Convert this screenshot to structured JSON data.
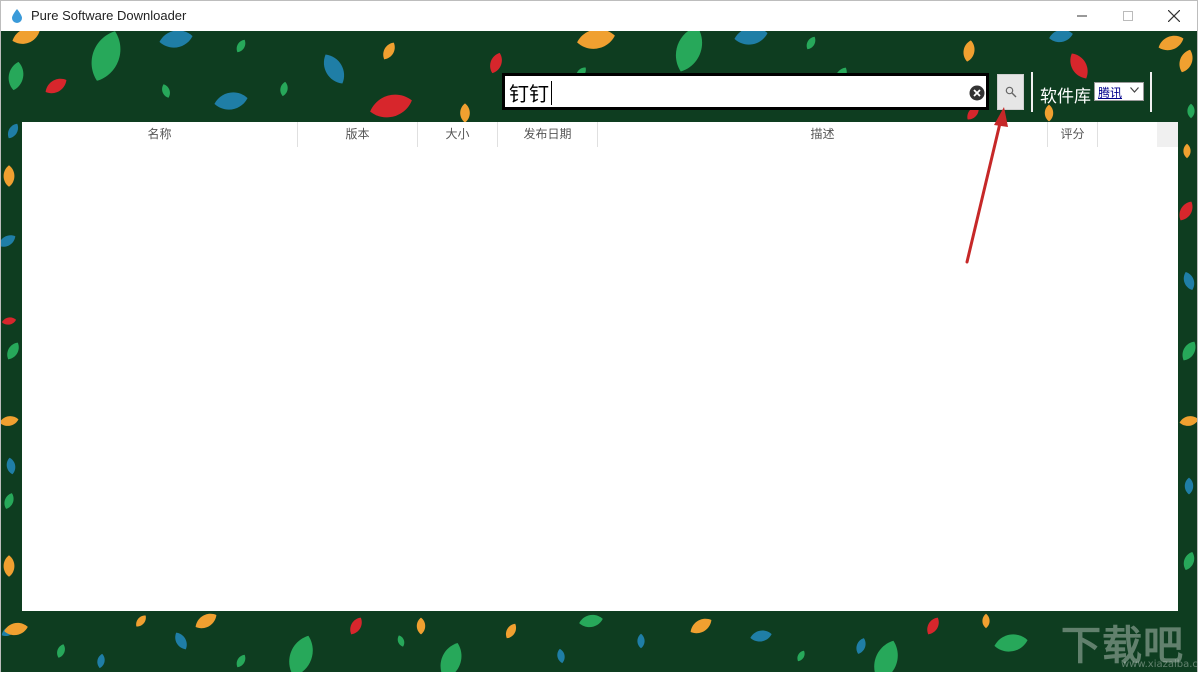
{
  "window": {
    "title": "Pure Software Downloader",
    "minimize_icon": "minimize-icon",
    "maximize_icon": "maximize-icon",
    "close_icon": "close-icon"
  },
  "search": {
    "value": "钉钉",
    "clear_icon": "clear-circle-icon",
    "button_icon": "search-icon"
  },
  "library": {
    "label": "软件库",
    "selected": "腾讯"
  },
  "table": {
    "columns": [
      "名称",
      "版本",
      "大小",
      "发布日期",
      "描述",
      "评分"
    ],
    "rows": []
  },
  "watermark": {
    "text": "下载吧",
    "sub": "www.xiazaiba.com"
  },
  "colors": {
    "background": "#0e3d20",
    "leaf_green": "#27a85a",
    "leaf_blue": "#1f7ea6",
    "leaf_orange": "#f0a030",
    "leaf_red": "#d7262c",
    "annotation_arrow": "#c62828"
  }
}
